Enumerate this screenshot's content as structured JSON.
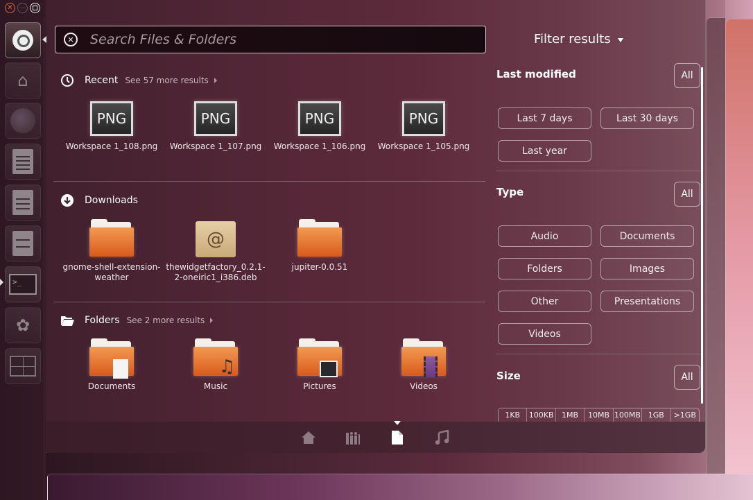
{
  "window_controls": {
    "close": "close",
    "minimize": "minimize",
    "maximize": "maximize"
  },
  "launcher": {
    "items": [
      {
        "name": "dash-home",
        "icon": "ubuntu-logo-icon"
      },
      {
        "name": "home-folder",
        "icon": "home-folder-icon"
      },
      {
        "name": "firefox",
        "icon": "firefox-icon"
      },
      {
        "name": "libreoffice-writer",
        "icon": "writer-icon"
      },
      {
        "name": "libreoffice-calc",
        "icon": "calc-icon"
      },
      {
        "name": "libreoffice-impress",
        "icon": "impress-icon"
      },
      {
        "name": "terminal",
        "icon": "terminal-icon"
      },
      {
        "name": "software-center",
        "icon": "software-center-icon"
      },
      {
        "name": "workspace-switcher",
        "icon": "workspace-switcher-icon"
      }
    ],
    "terminal_prompt": ">_"
  },
  "search": {
    "placeholder": "Search Files & Folders",
    "value": "",
    "clear_icon": "clear-icon"
  },
  "sections": {
    "recent": {
      "title": "Recent",
      "more": "See 57 more results",
      "icon": "clock-icon",
      "items": [
        {
          "label": "Workspace 1_108.png",
          "thumb": "PNG"
        },
        {
          "label": "Workspace 1_107.png",
          "thumb": "PNG"
        },
        {
          "label": "Workspace 1_106.png",
          "thumb": "PNG"
        },
        {
          "label": "Workspace 1_105.png",
          "thumb": "PNG"
        }
      ]
    },
    "downloads": {
      "title": "Downloads",
      "icon": "download-icon",
      "items": [
        {
          "label_line1": "gnome-shell-extension-",
          "label_line2": "weather",
          "type": "folder"
        },
        {
          "label_line1": "thewidgetfactory_0.2.1-",
          "label_line2": "2-oneiric1_i386.deb",
          "type": "deb-package"
        },
        {
          "label_line1": "jupiter-0.0.51",
          "label_line2": "",
          "type": "folder"
        }
      ]
    },
    "folders": {
      "title": "Folders",
      "more": "See 2 more results",
      "icon": "folder-icon",
      "items": [
        {
          "label": "Documents",
          "emblem": "document"
        },
        {
          "label": "Music",
          "emblem": "music"
        },
        {
          "label": "Pictures",
          "emblem": "pictures"
        },
        {
          "label": "Videos",
          "emblem": "videos"
        }
      ]
    }
  },
  "filter": {
    "header": "Filter results",
    "last_modified": {
      "title": "Last modified",
      "all": "All",
      "options": [
        "Last 7 days",
        "Last 30 days",
        "Last year"
      ]
    },
    "type": {
      "title": "Type",
      "all": "All",
      "options": [
        "Audio",
        "Documents",
        "Folders",
        "Images",
        "Other",
        "Presentations",
        "Videos"
      ]
    },
    "size": {
      "title": "Size",
      "all": "All",
      "options": [
        "1KB",
        "100KB",
        "1MB",
        "10MB",
        "100MB",
        "1GB",
        ">1GB"
      ]
    }
  },
  "lenses": [
    {
      "name": "home",
      "icon": "home-icon",
      "active": false
    },
    {
      "name": "applications",
      "icon": "applications-icon",
      "active": false
    },
    {
      "name": "files",
      "icon": "file-icon",
      "active": true
    },
    {
      "name": "music",
      "icon": "music-icon",
      "active": false
    }
  ]
}
